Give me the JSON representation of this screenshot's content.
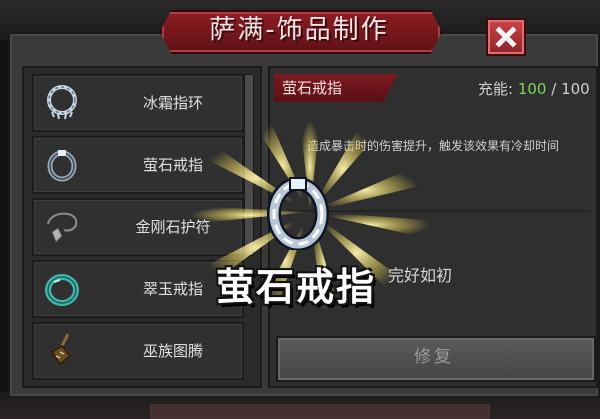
{
  "window": {
    "title": "萨满-饰品制作"
  },
  "list": {
    "items": [
      {
        "label": "冰霜指环",
        "icon": "frost-ring-icon"
      },
      {
        "label": "萤石戒指",
        "icon": "fluorite-ring-icon"
      },
      {
        "label": "金刚石护符",
        "icon": "diamond-amulet-icon"
      },
      {
        "label": "翠玉戒指",
        "icon": "jade-ring-icon"
      },
      {
        "label": "巫族图腾",
        "icon": "witch-totem-icon"
      }
    ]
  },
  "detail": {
    "name": "萤石戒指",
    "energy_label": "充能:",
    "energy_current": "100",
    "energy_sep": " / ",
    "energy_max": "100",
    "description": "造成暴击时的伤害提升，触发该效果有冷却时间",
    "status": "完好如初",
    "repair_label": "修复"
  },
  "popup": {
    "name": "萤石戒指"
  },
  "colors": {
    "accent": "#8e1d23",
    "energy": "#7fd65a",
    "panel": "#2f2f2f"
  }
}
